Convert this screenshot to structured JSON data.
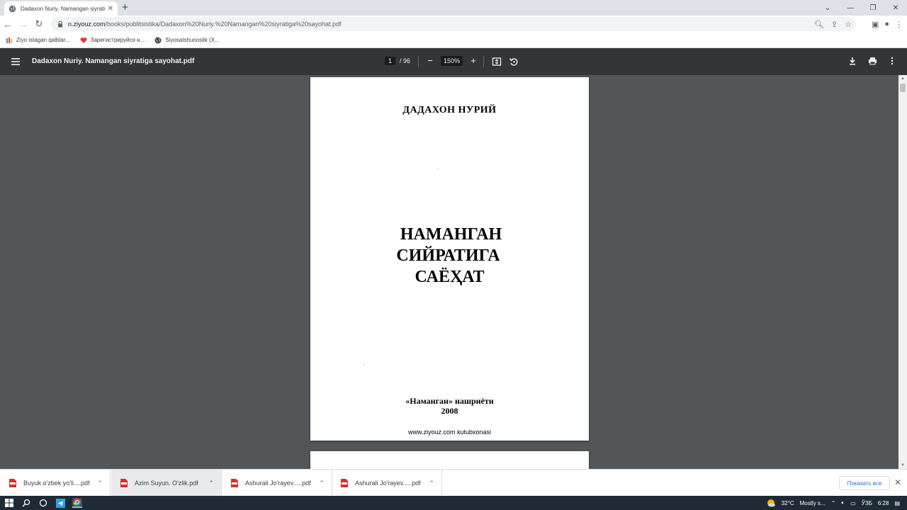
{
  "browser": {
    "tab_title": "Dadaxon Nuriy. Namangan siyrati",
    "url_host": "n.ziyouz.com",
    "url_path": "/books/publitsistika/Dadaxon%20Nuriy.%20Namangan%20siyratiga%20sayohat.pdf",
    "bookmarks": [
      {
        "label": "Ziyo istagan qalblar..."
      },
      {
        "label": "Зарегистрируйся н..."
      },
      {
        "label": "Siyosatshunoslik (X..."
      }
    ]
  },
  "pdf_toolbar": {
    "title": "Dadaxon Nuriy. Namangan siyratiga sayohat.pdf",
    "current_page": "1",
    "total_pages": "/ 96",
    "zoom": "150%"
  },
  "page": {
    "author": "ДАДАХОН НУРИЙ",
    "title_line1": "НАМАНГАН",
    "title_line2": "СИЙРАТИГА",
    "title_line3": "САЁҲАТ",
    "publisher": "«Наманган» нашриёти",
    "year": "2008",
    "site": "www.ziyouz.com kutubxonasi"
  },
  "downloads": {
    "items": [
      {
        "label": "Buyuk o'zbek yo'li....pdf"
      },
      {
        "label": "Azim Suyun. O'zlik.pdf"
      },
      {
        "label": "Ashurali Jo'rayev.....pdf"
      },
      {
        "label": "Ashurali Jo'rayev.....pdf"
      }
    ],
    "show_all": "Показать все"
  },
  "taskbar": {
    "temperature": "32°C",
    "weather": "Mostly s...",
    "language": "ЎЗБ",
    "time": "6:28"
  },
  "colors": {
    "toolbar_bg": "#323639",
    "viewer_bg": "#525659",
    "accent": "#1a73e8",
    "pdf_icon": "#d93025"
  }
}
